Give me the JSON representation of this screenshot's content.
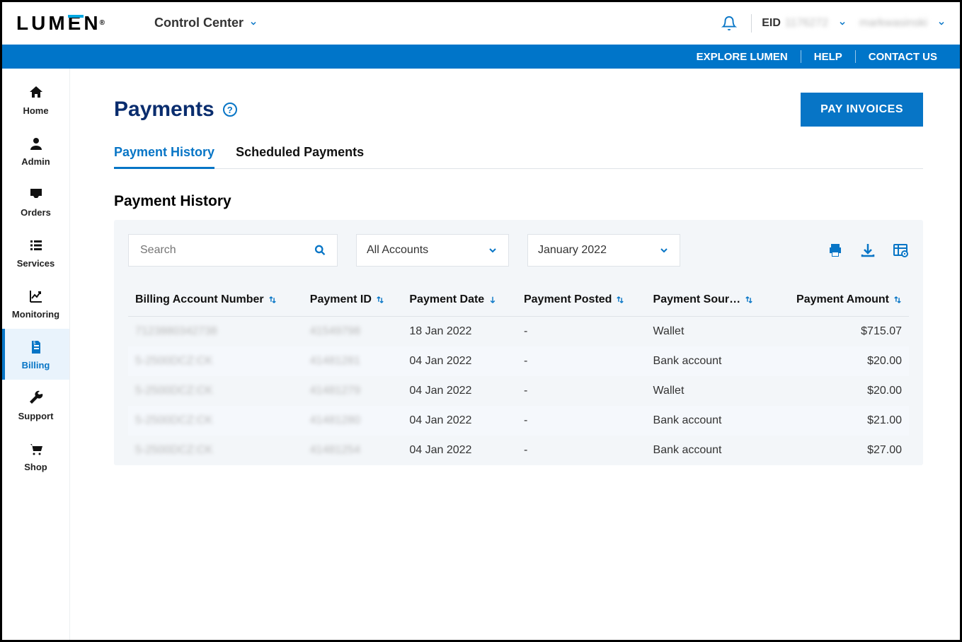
{
  "header": {
    "brand": "LUMEN",
    "app_switcher": "Control Center",
    "eid_label": "EID",
    "eid_value": "1176272",
    "username": "markwasinski"
  },
  "topbar": {
    "explore": "EXPLORE LUMEN",
    "help": "HELP",
    "contact": "CONTACT US"
  },
  "sidebar": {
    "items": [
      {
        "label": "Home"
      },
      {
        "label": "Admin"
      },
      {
        "label": "Orders"
      },
      {
        "label": "Services"
      },
      {
        "label": "Monitoring"
      },
      {
        "label": "Billing"
      },
      {
        "label": "Support"
      },
      {
        "label": "Shop"
      }
    ]
  },
  "page": {
    "title": "Payments",
    "pay_button": "PAY INVOICES",
    "tabs": {
      "history": "Payment History",
      "scheduled": "Scheduled Payments"
    },
    "sub_heading": "Payment History"
  },
  "filters": {
    "search_placeholder": "Search",
    "account": "All Accounts",
    "period": "January 2022"
  },
  "table": {
    "columns": {
      "ban": "Billing Account Number",
      "pid": "Payment ID",
      "pdate": "Payment Date",
      "pposted": "Payment Posted",
      "psource": "Payment Sour…",
      "pamount": "Payment Amount"
    },
    "rows": [
      {
        "ban": "7123880342738",
        "pid": "41549798",
        "pdate": "18 Jan 2022",
        "pposted": "-",
        "psource": "Wallet",
        "pamount": "$715.07"
      },
      {
        "ban": "5-2500DCZ:CK",
        "pid": "41481281",
        "pdate": "04 Jan 2022",
        "pposted": "-",
        "psource": "Bank account",
        "pamount": "$20.00"
      },
      {
        "ban": "5-2500DCZ:CK",
        "pid": "41481279",
        "pdate": "04 Jan 2022",
        "pposted": "-",
        "psource": "Wallet",
        "pamount": "$20.00"
      },
      {
        "ban": "5-2500DCZ:CK",
        "pid": "41481280",
        "pdate": "04 Jan 2022",
        "pposted": "-",
        "psource": "Bank account",
        "pamount": "$21.00"
      },
      {
        "ban": "5-2500DCZ:CK",
        "pid": "41481254",
        "pdate": "04 Jan 2022",
        "pposted": "-",
        "psource": "Bank account",
        "pamount": "$27.00"
      }
    ]
  }
}
